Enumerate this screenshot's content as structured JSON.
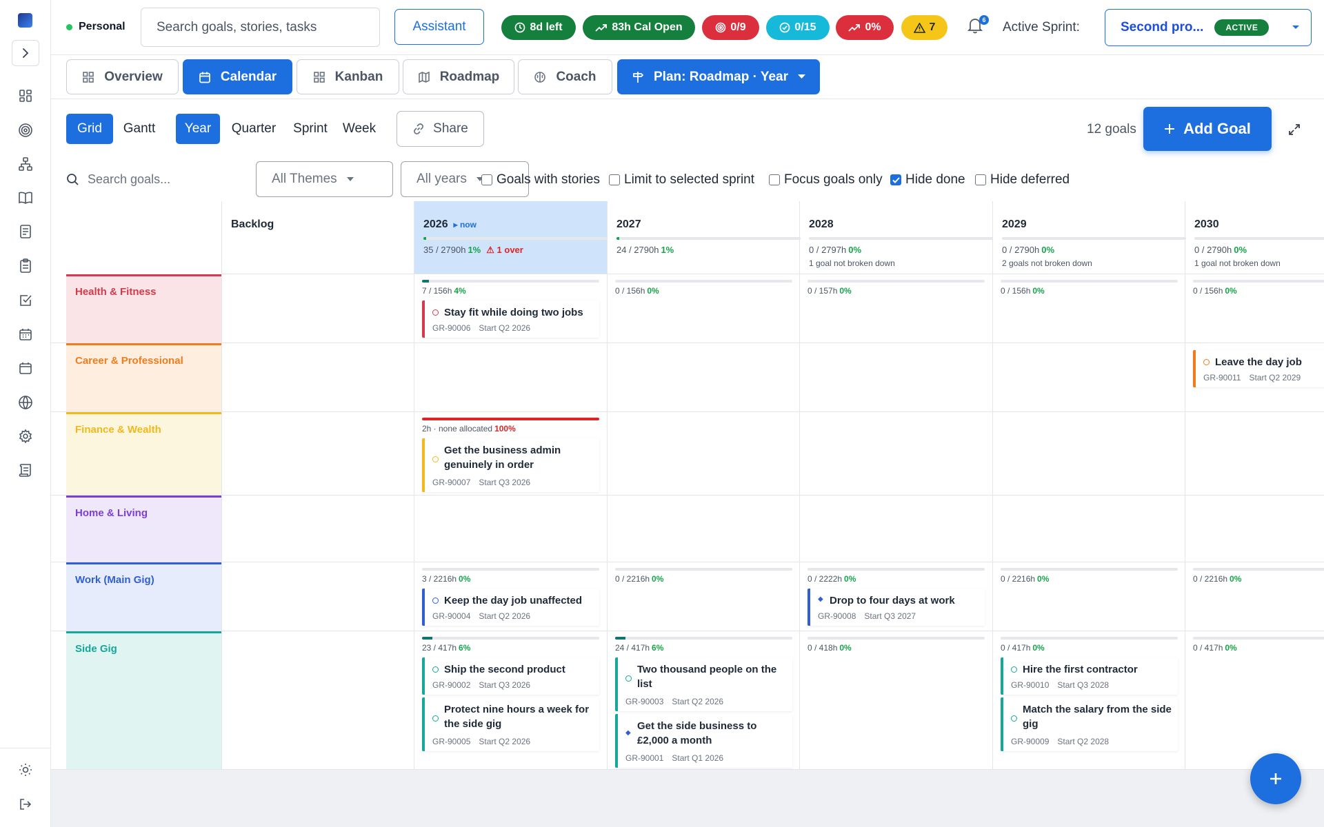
{
  "topbar": {
    "workspace": "Personal",
    "search_placeholder": "Search goals, stories, tasks",
    "assistant_label": "Assistant",
    "pills": [
      {
        "icon": "clock-icon",
        "label": "8d left",
        "color": "#15803d"
      },
      {
        "icon": "trend-up-icon",
        "label": "83h Cal Open",
        "color": "#15803d"
      },
      {
        "icon": "target-icon",
        "label": "0/9",
        "color": "#dc2f3e"
      },
      {
        "icon": "check-circle-icon",
        "label": "0/15",
        "color": "#16b9da"
      },
      {
        "icon": "trend-up-icon",
        "label": "0%",
        "color": "#dc2f3e"
      },
      {
        "icon": "warning-icon",
        "label": "7",
        "color": "#f5c518"
      }
    ],
    "notification_count": "6",
    "active_sprint_label": "Active Sprint:",
    "sprint_name": "Second pro...",
    "sprint_status": "ACTIVE"
  },
  "view_tabs": [
    {
      "label": "Overview",
      "icon": "dashboard-icon",
      "active": false
    },
    {
      "label": "Calendar",
      "icon": "calendar-icon",
      "active": true
    },
    {
      "label": "Kanban",
      "icon": "grid-icon",
      "active": false
    },
    {
      "label": "Roadmap",
      "icon": "map-icon",
      "active": false
    },
    {
      "label": "Coach",
      "icon": "brain-icon",
      "active": false
    }
  ],
  "plan_menu": "Plan: Roadmap · Year",
  "toolbar": {
    "layout_options": [
      "Grid",
      "Gantt"
    ],
    "layout_selected": "Grid",
    "scale_options": [
      "Year",
      "Quarter",
      "Sprint",
      "Week"
    ],
    "scale_selected": "Year",
    "share_label": "Share",
    "goal_count": "12 goals",
    "add_goal_label": "Add Goal",
    "goal_search_placeholder": "Search goals...",
    "themes_filter": "All Themes",
    "years_filter": "All years",
    "checkboxes": [
      {
        "label": "Goals with stories",
        "checked": false
      },
      {
        "label": "Limit to selected sprint",
        "checked": false
      },
      {
        "label": "Focus goals only",
        "checked": false
      },
      {
        "label": "Hide done",
        "checked": true
      },
      {
        "label": "Hide deferred",
        "checked": false
      }
    ]
  },
  "columns": [
    {
      "label": "Backlog"
    },
    {
      "label": "2026",
      "now": "now",
      "hours": "35 / 2790h",
      "pct": "1%",
      "progress": 0.01,
      "over": "1 over",
      "current": true
    },
    {
      "label": "2027",
      "hours": "24 / 2790h",
      "pct": "1%",
      "progress": 0.01
    },
    {
      "label": "2028",
      "hours": "0 / 2797h",
      "pct": "0%",
      "progress": 0,
      "note": "1 goal not broken down"
    },
    {
      "label": "2029",
      "hours": "0 / 2790h",
      "pct": "0%",
      "progress": 0,
      "note": "2 goals not broken down"
    },
    {
      "label": "2030",
      "hours": "0 / 2790h",
      "pct": "0%",
      "progress": 0,
      "note": "1 goal not broken down"
    }
  ],
  "themes": [
    {
      "name": "Health & Fitness",
      "color": "#d33a4b",
      "bg": "#fbe4e7",
      "cells": [
        null,
        {
          "hours": "7 / 156h",
          "pct": "4%",
          "progress": 0.04,
          "goals": [
            {
              "title": "Stay fit while doing two jobs",
              "id": "GR-90006",
              "start": "Start Q2 2026"
            }
          ]
        },
        {
          "hours": "0 / 156h",
          "pct": "0%",
          "progress": 0,
          "goals": []
        },
        {
          "hours": "0 / 157h",
          "pct": "0%",
          "progress": 0,
          "goals": []
        },
        {
          "hours": "0 / 156h",
          "pct": "0%",
          "progress": 0,
          "goals": []
        },
        {
          "hours": "0 / 156h",
          "pct": "0%",
          "progress": 0,
          "goals": []
        }
      ]
    },
    {
      "name": "Career & Professional",
      "color": "#f07d1a",
      "bg": "#fdeee0",
      "cells": [
        null,
        null,
        null,
        null,
        null,
        {
          "goals": [
            {
              "title": "Leave the day job",
              "id": "GR-90011",
              "start": "Start Q2 2029"
            }
          ]
        }
      ]
    },
    {
      "name": "Finance & Wealth",
      "color": "#f2b91c",
      "bg": "#fdf6de",
      "cells": [
        null,
        {
          "hours": "2h · none allocated",
          "pct": "100%",
          "progress": 1,
          "over_budget": true,
          "goals": [
            {
              "title": "Get the business admin genuinely in order",
              "id": "GR-90007",
              "start": "Start Q3 2026"
            }
          ]
        },
        null,
        null,
        null,
        null
      ]
    },
    {
      "name": "Home & Living",
      "color": "#7c3fd6",
      "bg": "#efe8fb",
      "cells": [
        null,
        null,
        null,
        null,
        null,
        null
      ]
    },
    {
      "name": "Work (Main Gig)",
      "color": "#2f5fd0",
      "bg": "#e6ecfb",
      "cells": [
        null,
        {
          "hours": "3 / 2216h",
          "pct": "0%",
          "progress": 0,
          "goals": [
            {
              "title": "Keep the day job unaffected",
              "id": "GR-90004",
              "start": "Start Q2 2026"
            }
          ]
        },
        {
          "hours": "0 / 2216h",
          "pct": "0%",
          "progress": 0,
          "goals": []
        },
        {
          "hours": "0 / 2222h",
          "pct": "0%",
          "progress": 0,
          "goals": [
            {
              "title": "Drop to four days at work",
              "id": "GR-90008",
              "start": "Start Q3 2027",
              "diamond": true
            }
          ]
        },
        {
          "hours": "0 / 2216h",
          "pct": "0%",
          "progress": 0,
          "goals": []
        },
        {
          "hours": "0 / 2216h",
          "pct": "0%",
          "progress": 0,
          "goals": []
        }
      ]
    },
    {
      "name": "Side Gig",
      "color": "#14a79a",
      "bg": "#e0f4f1",
      "cells": [
        null,
        {
          "hours": "23 / 417h",
          "pct": "6%",
          "progress": 0.06,
          "goals": [
            {
              "title": "Ship the second product",
              "id": "GR-90002",
              "start": "Start Q3 2026"
            },
            {
              "title": "Protect nine hours a week for the side gig",
              "id": "GR-90005",
              "start": "Start Q2 2026"
            }
          ]
        },
        {
          "hours": "24 / 417h",
          "pct": "6%",
          "progress": 0.06,
          "goals": [
            {
              "title": "Two thousand people on the list",
              "id": "GR-90003",
              "start": "Start Q2 2026"
            },
            {
              "title": "Get the side business to £2,000 a month",
              "id": "GR-90001",
              "start": "Start Q1 2026",
              "diamond": true
            }
          ]
        },
        {
          "hours": "0 / 418h",
          "pct": "0%",
          "progress": 0,
          "goals": []
        },
        {
          "hours": "0 / 417h",
          "pct": "0%",
          "progress": 0,
          "goals": [
            {
              "title": "Hire the first contractor",
              "id": "GR-90010",
              "start": "Start Q3 2028"
            },
            {
              "title": "Match the salary from the side gig",
              "id": "GR-90009",
              "start": "Start Q2 2028"
            }
          ]
        },
        {
          "hours": "0 / 417h",
          "pct": "0%",
          "progress": 0,
          "goals": []
        }
      ]
    }
  ]
}
